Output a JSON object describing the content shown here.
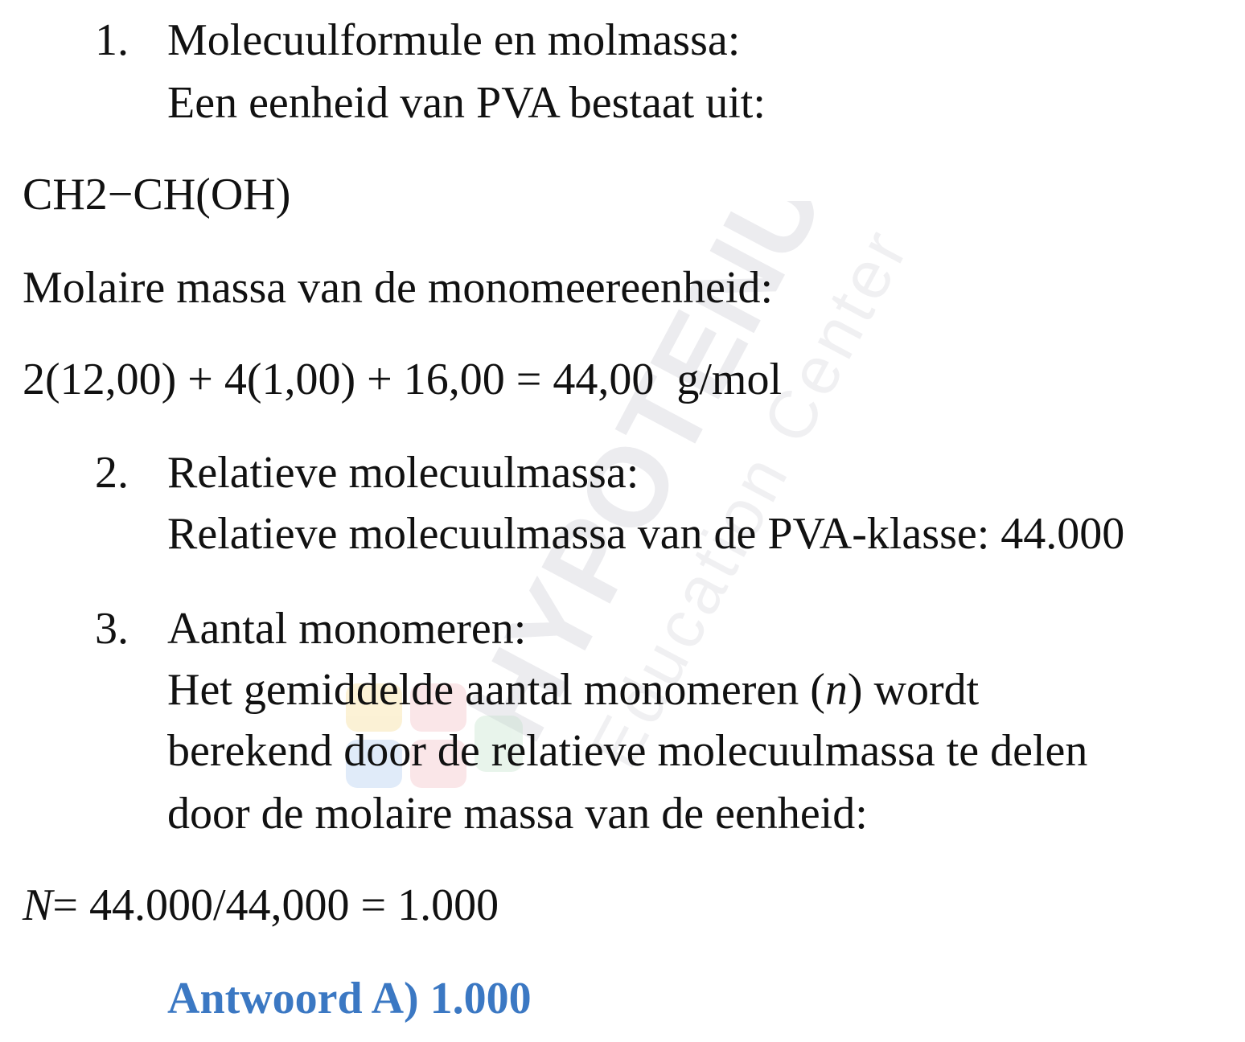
{
  "watermark": {
    "brand": "HYPOTENUSE",
    "tagline": "Education Center"
  },
  "step1": {
    "number": "1.",
    "heading": "Molecuulformule en molmassa:",
    "text": "Een eenheid van PVA bestaat uit:"
  },
  "formula": "CH2−CH(OH)",
  "molar_heading": "Molaire massa van de monomeereenheid:",
  "molar_calc": {
    "expression": "2(12,00) + 4(1,00) + 16,00 = 44,00",
    "unit": "g/mol"
  },
  "step2": {
    "number": "2.",
    "heading": "Relatieve molecuulmassa:",
    "text": "Relatieve molecuulmassa van de PVA-klasse: 44.000"
  },
  "step3": {
    "number": "3.",
    "heading": "Aantal monomeren:",
    "text_line1_a": "Het gemiddelde aantal monomeren (",
    "text_line1_var": "n",
    "text_line1_b": ") wordt",
    "text_line2": "berekend door de relatieve molecuulmassa te delen",
    "text_line3": "door de molaire massa van de eenheid:"
  },
  "result": {
    "var": "N",
    "expression": "= 44.000/44,000 = 1.000"
  },
  "answer": "Antwoord A) 1.000",
  "colors": {
    "answer": "#3b78c3",
    "text": "#111111",
    "watermark": "#e9e9ec"
  }
}
